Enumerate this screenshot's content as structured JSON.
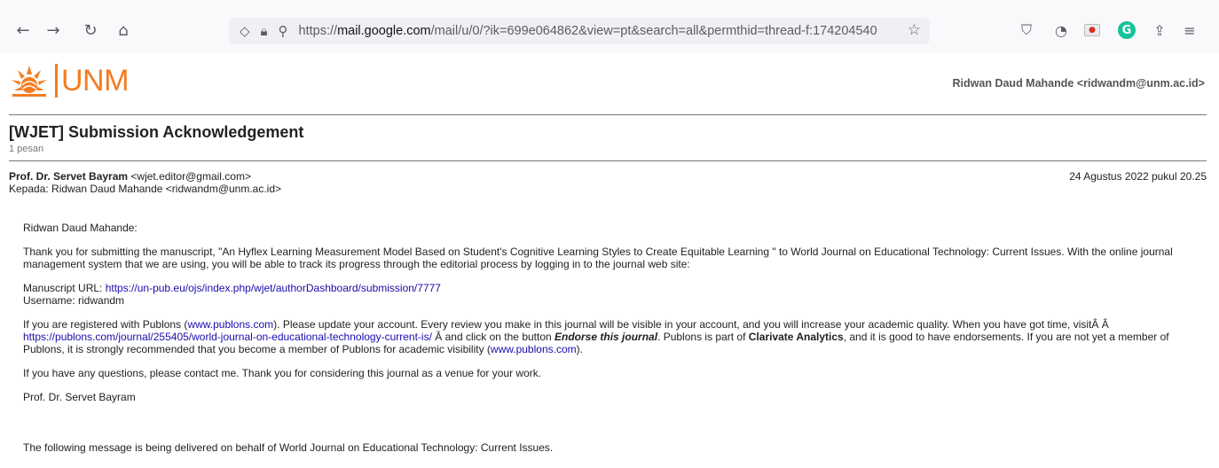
{
  "browser": {
    "url_scheme": "https://",
    "url_host": "mail.google.com",
    "url_path": "/mail/u/0/?ik=699e064862&view=pt&search=all&permthid=thread-f:174204540",
    "icons": [
      "back-icon",
      "forward-icon",
      "reload-icon",
      "home-icon",
      "shield-icon",
      "lock-icon",
      "permissions-icon",
      "bookmark-star-icon",
      "pocket-icon",
      "extension-timer-icon",
      "gmail-extension-icon",
      "grammarly-icon",
      "share-icon",
      "menu-icon"
    ]
  },
  "org": {
    "logo_text": "UNM",
    "brand_color": "#f47c20"
  },
  "account": {
    "label": "Ridwan Daud Mahande <ridwandm@unm.ac.id>"
  },
  "thread": {
    "subject": "[WJET] Submission Acknowledgement",
    "count": "1 pesan"
  },
  "message": {
    "from_name": "Prof. Dr. Servet Bayram",
    "from_email": "<wjet.editor@gmail.com>",
    "date": "24 Agustus 2022 pukul 20.25",
    "to": "Kepada: Ridwan Daud Mahande <ridwandm@unm.ac.id>",
    "greeting": "Ridwan Daud Mahande:",
    "p1": "Thank you for submitting the manuscript, \"An Hyflex Learning Measurement Model Based on Student's Cognitive Learning Styles to Create Equitable Learning \" to World Journal on Educational Technology: Current Issues. With the online journal management system that we are using, you will be able to track its progress through the editorial process by logging in to the journal web site:",
    "manuscript_label": "Manuscript URL: ",
    "manuscript_url": "https://un-pub.eu/ojs/index.php/wjet/authorDashboard/submission/7777",
    "username": "Username: ridwandm",
    "p3_a": "If you are registered with Publons (",
    "publons_link": "www.publons.com",
    "p3_b": "). Please update your account. Every review you make in this journal will be visible in your account, and you will increase your academic quality. When you have got time, visitÂ Â ",
    "publons_journal_url": "https://publons.com/journal/255405/world-journal-on-educational-technology-current-is/",
    "p3_c": " Â and click on the button ",
    "endorse": "Endorse this journal",
    "p3_d": ". Publons is part of ",
    "clarivate": "Clarivate Analytics",
    "p3_e": ", and it is good to have endorsements. If you are not yet a member of Publons, it is strongly recommended that you become a member of Publons for academic visibility (",
    "publons_link2": "www.publons.com",
    "p3_f": ").",
    "p4": "If you have any questions, please contact me. Thank you for considering this journal as a venue for your work.",
    "signature": "Prof. Dr. Servet Bayram",
    "footer": "The following message is being delivered on behalf of World Journal on Educational Technology: Current Issues."
  }
}
